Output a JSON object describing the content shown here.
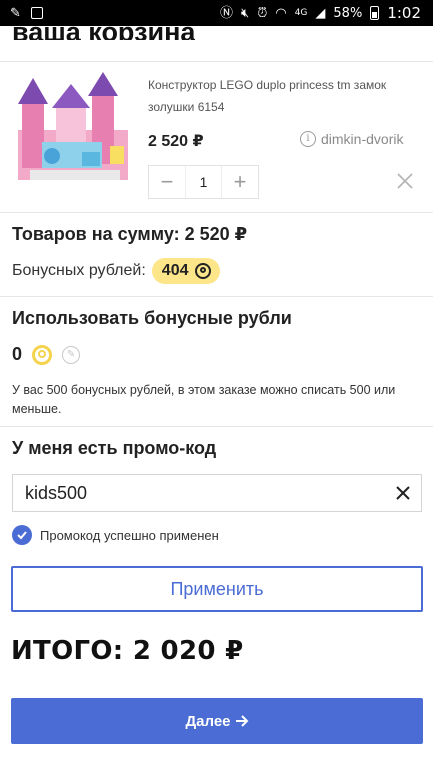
{
  "status_bar": {
    "battery": "58%",
    "time": "1:02",
    "network": "4G"
  },
  "page": {
    "title": "ваша корзина"
  },
  "product": {
    "name": "Конструктор LEGO duplo princess tm замок золушки 6154",
    "price": "2 520 ₽",
    "seller": "dimkin-dvorik",
    "quantity": "1",
    "minus_label": "−",
    "plus_label": "+"
  },
  "summary": {
    "sum_text": "Товаров на сумму: 2 520 ₽",
    "bonus_label": "Бонусных рублей:",
    "bonus_value": "404"
  },
  "use_bonus": {
    "title": "Использовать бонусные рубли",
    "value": "0",
    "note": "У вас 500 бонусных рублей, в этом заказе можно списать 500 или меньше."
  },
  "promo": {
    "title": "У меня есть промо-код",
    "value": "kids500",
    "success_text": "Промокод успешно применен",
    "apply_label": "Применить"
  },
  "total": {
    "text": "ИТОГО: 2 020 ₽"
  },
  "next_button": {
    "label": "Далее"
  },
  "colors": {
    "accent": "#4a6cd4",
    "bonus_badge": "#fde58a",
    "coin": "#f4d34d"
  },
  "icons": [
    "nfc-icon",
    "mute-icon",
    "alarm-icon",
    "wifi-icon",
    "signal-icon",
    "battery-icon",
    "info-icon",
    "close-icon",
    "coin-icon",
    "edit-icon",
    "check-icon",
    "arrow-right-icon"
  ]
}
